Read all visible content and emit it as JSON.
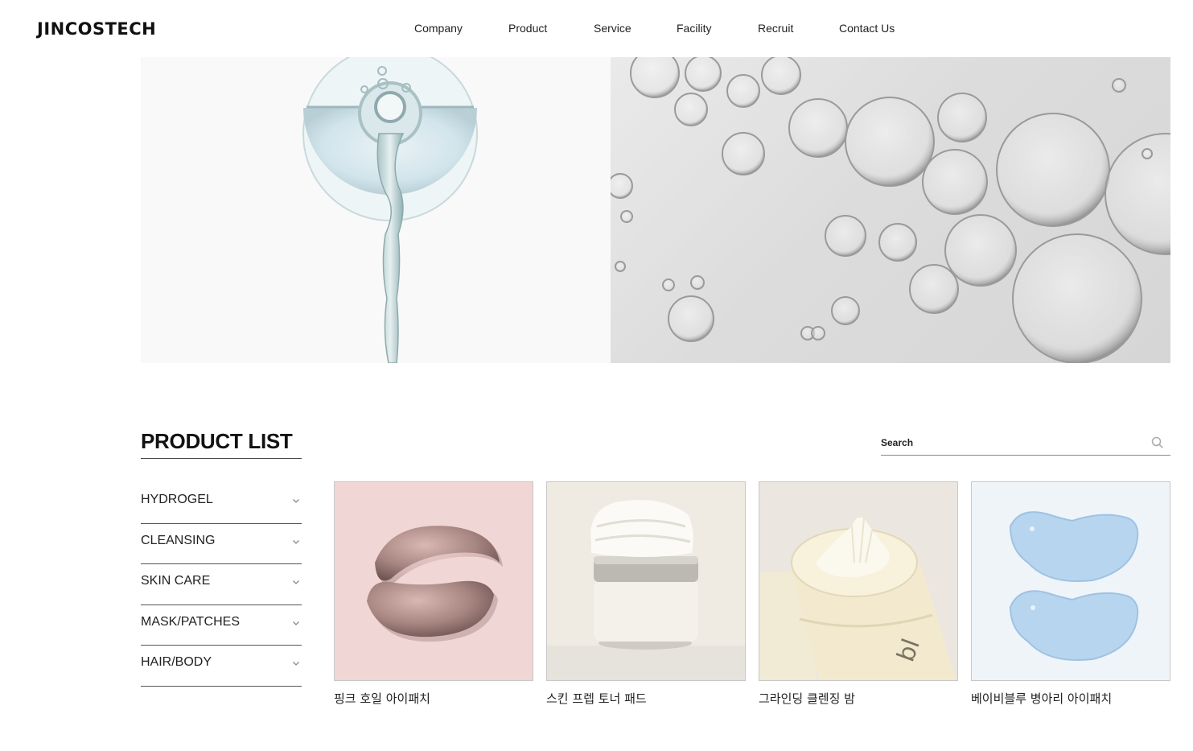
{
  "brand": {
    "logo_text": "JINCOSTECH"
  },
  "nav": {
    "items": [
      {
        "label": "Company"
      },
      {
        "label": "Product"
      },
      {
        "label": "Service"
      },
      {
        "label": "Facility"
      },
      {
        "label": "Recruit"
      },
      {
        "label": "Contact Us"
      }
    ]
  },
  "hero": {
    "left_image": "water-pour-image",
    "right_image": "bubbles-image"
  },
  "product_list": {
    "title": "PRODUCT LIST",
    "search": {
      "placeholder": "Search",
      "icon": "search-icon"
    },
    "categories": [
      {
        "label": "HYDROGEL",
        "icon": "chevron-down-icon"
      },
      {
        "label": "CLEANSING",
        "icon": "chevron-down-icon"
      },
      {
        "label": "SKIN CARE",
        "icon": "chevron-down-icon"
      },
      {
        "label": "MASK/PATCHES",
        "icon": "chevron-down-icon"
      },
      {
        "label": "HAIR/BODY",
        "icon": "chevron-down-icon"
      }
    ],
    "products": [
      {
        "name": "핑크 호일 아이패치",
        "bg": "#f1d6d6"
      },
      {
        "name": "스킨 프렙 토너 패드",
        "bg": "#efebe3"
      },
      {
        "name": "그라인딩 클렌징 밤",
        "bg": "#ebe6df"
      },
      {
        "name": "베이비블루 병아리 아이패치",
        "bg": "#eef4f8"
      }
    ]
  }
}
